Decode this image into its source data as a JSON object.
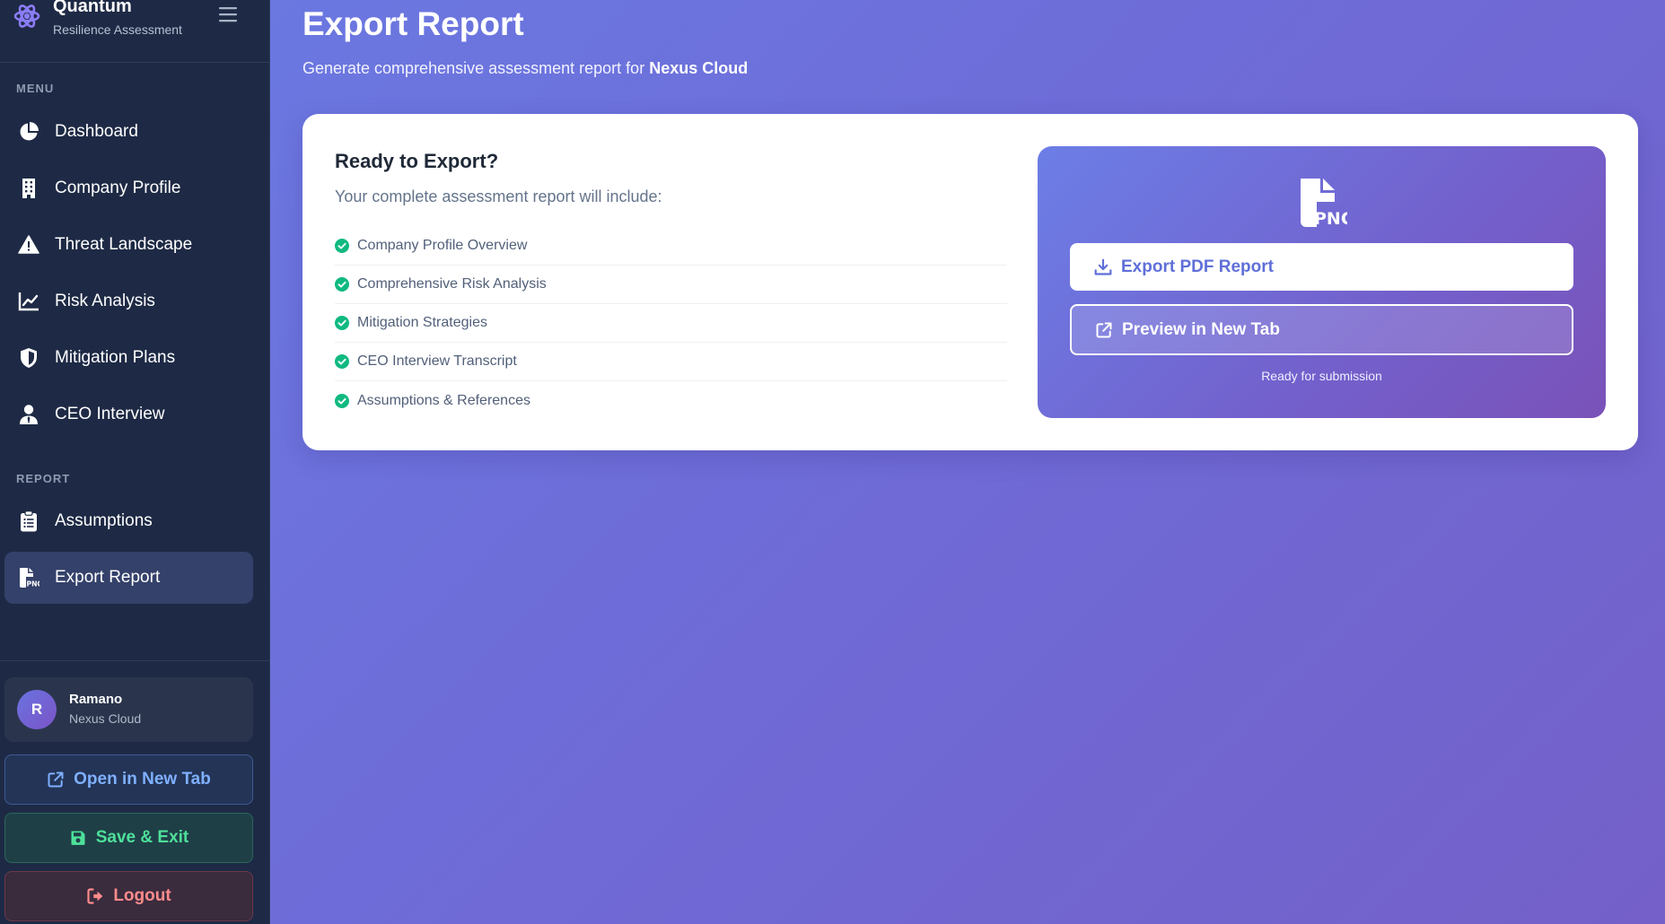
{
  "brand": {
    "title": "Quantum",
    "subtitle": "Resilience Assessment"
  },
  "sidebar": {
    "menu_label": "MENU",
    "report_label": "REPORT",
    "menu_items": [
      {
        "label": "Dashboard",
        "icon": "chart-pie-icon"
      },
      {
        "label": "Company Profile",
        "icon": "building-icon"
      },
      {
        "label": "Threat Landscape",
        "icon": "warning-triangle-icon"
      },
      {
        "label": "Risk Analysis",
        "icon": "line-chart-icon"
      },
      {
        "label": "Mitigation Plans",
        "icon": "shield-icon"
      },
      {
        "label": "CEO Interview",
        "icon": "user-tie-icon"
      }
    ],
    "report_items": [
      {
        "label": "Assumptions",
        "icon": "clipboard-list-icon"
      },
      {
        "label": "Export Report",
        "icon": "file-png-icon",
        "active": true
      }
    ],
    "user": {
      "initial": "R",
      "name": "Ramano",
      "company": "Nexus Cloud"
    },
    "buttons": {
      "open_new_tab": "Open in New Tab",
      "save_exit": "Save & Exit",
      "logout": "Logout"
    }
  },
  "main": {
    "title": "Export Report",
    "subtitle_prefix": "Generate comprehensive assessment report for",
    "company": "Nexus Cloud",
    "card": {
      "title": "Ready to Export?",
      "subtitle": "Your complete assessment report will include:",
      "items": [
        "Company Profile Overview",
        "Comprehensive Risk Analysis",
        "Mitigation Strategies",
        "CEO Interview Transcript",
        "Assumptions & References"
      ]
    },
    "export_panel": {
      "icon": "file-png-icon",
      "export_pdf": "Export PDF Report",
      "preview": "Preview in New Tab",
      "status": "Ready for submission"
    }
  },
  "colors": {
    "sidebar_bg": "#1e2a45",
    "accent": "#5f6fd8",
    "success": "#10b981",
    "danger": "#ff8c8c"
  }
}
